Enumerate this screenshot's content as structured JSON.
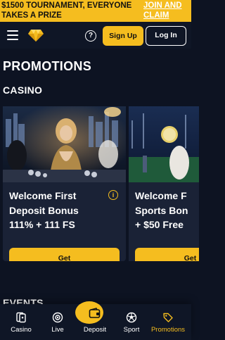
{
  "banner": {
    "text": "$1500 TOURNAMENT, EVERYONE TAKES A PRIZE",
    "link": "JOIN AND CLAIM"
  },
  "header": {
    "signup_label": "Sign Up",
    "login_label": "Log In",
    "help_glyph": "?"
  },
  "page": {
    "title": "PROMOTIONS",
    "section_casino": "CASINO",
    "section_events": "EVENTS"
  },
  "cards": [
    {
      "title_line1": "Welcome First",
      "title_line2": "Deposit Bonus",
      "title_line3": "111% + 111 FS",
      "button_label": "Get",
      "info_glyph": "i"
    },
    {
      "title_line1": "Welcome F",
      "title_line2": "Sports Bon",
      "title_line3": "+ $50 Free",
      "button_label": "Get"
    }
  ],
  "tabbar": {
    "items": [
      {
        "label": "Casino",
        "icon": "casino-icon"
      },
      {
        "label": "Live",
        "icon": "live-icon"
      },
      {
        "label": "Deposit",
        "icon": "wallet-icon"
      },
      {
        "label": "Sport",
        "icon": "soccer-ball-icon"
      },
      {
        "label": "Promotions",
        "icon": "promotions-tag-icon",
        "active": true
      }
    ]
  },
  "colors": {
    "accent": "#f5bd1f",
    "background": "#0d1322",
    "card": "#1a2236"
  }
}
